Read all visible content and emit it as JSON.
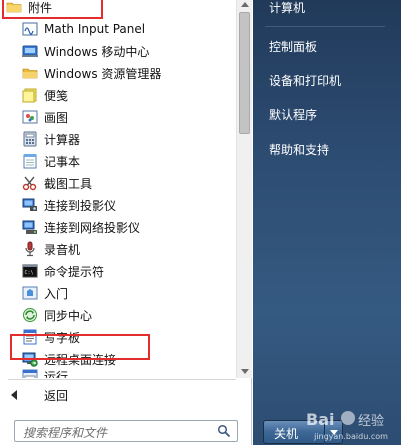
{
  "programs": {
    "folder_label": "附件",
    "items": [
      {
        "label": "Math Input Panel",
        "icon": "math-input-icon"
      },
      {
        "label": "Windows 移动中心",
        "icon": "mobility-center-icon"
      },
      {
        "label": "Windows 资源管理器",
        "icon": "explorer-folder-icon"
      },
      {
        "label": "便笺",
        "icon": "sticky-note-icon"
      },
      {
        "label": "画图",
        "icon": "paint-icon"
      },
      {
        "label": "计算器",
        "icon": "calculator-icon"
      },
      {
        "label": "记事本",
        "icon": "notepad-icon"
      },
      {
        "label": "截图工具",
        "icon": "snipping-tool-icon"
      },
      {
        "label": "连接到投影仪",
        "icon": "projector-icon"
      },
      {
        "label": "连接到网络投影仪",
        "icon": "network-projector-icon"
      },
      {
        "label": "录音机",
        "icon": "microphone-icon"
      },
      {
        "label": "命令提示符",
        "icon": "command-prompt-icon"
      },
      {
        "label": "入门",
        "icon": "getting-started-icon"
      },
      {
        "label": "同步中心",
        "icon": "sync-center-icon"
      },
      {
        "label": "写字板",
        "icon": "wordpad-icon"
      },
      {
        "label": "远程桌面连接",
        "icon": "remote-desktop-icon"
      },
      {
        "label": "运行",
        "icon": "run-icon"
      }
    ]
  },
  "back_label": "返回",
  "search": {
    "placeholder": "搜索程序和文件"
  },
  "right_pane": {
    "links": [
      "计算机",
      "控制面板",
      "设备和打印机",
      "默认程序",
      "帮助和支持"
    ]
  },
  "shutdown_label": "关机",
  "watermark": {
    "logo_text": "Bai 经验",
    "caption": "jingyan.baidu.com"
  },
  "colors": {
    "highlight": "#e52c2c",
    "right_pane_bg": "#2d4c72"
  }
}
